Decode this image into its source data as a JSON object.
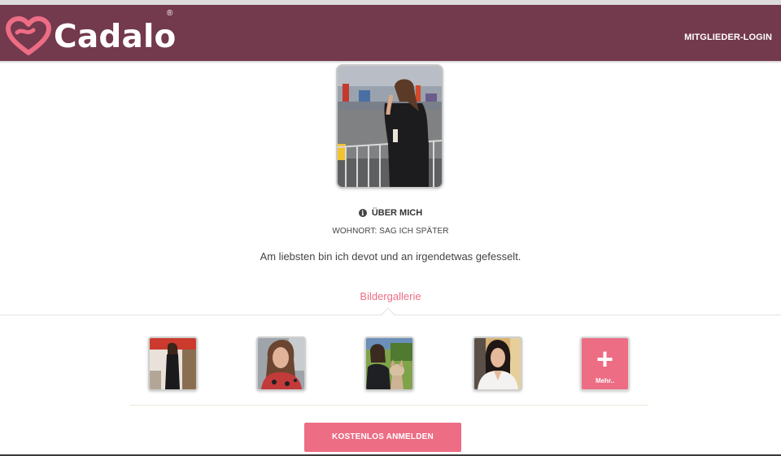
{
  "brand": {
    "name": "Cadalo",
    "trademark": "®",
    "logo_icon": "heart-icon",
    "header_color": "#73394d",
    "accent_color": "#ec6d84"
  },
  "header": {
    "login_label": "MITGLIEDER-LOGIN"
  },
  "profile": {
    "about_heading": "ÜBER MICH",
    "about_icon": "info-icon",
    "location": "WOHNORT: SAG ICH SPÄTER",
    "bio": "Am liebsten bin ich devot und an irgendetwas gefesselt."
  },
  "gallery": {
    "title": "Bildergallerie",
    "more_label": "Mehr..",
    "more_icon": "plus-icon"
  },
  "cta": {
    "signup_label": "KOSTENLOS ANMELDEN"
  }
}
